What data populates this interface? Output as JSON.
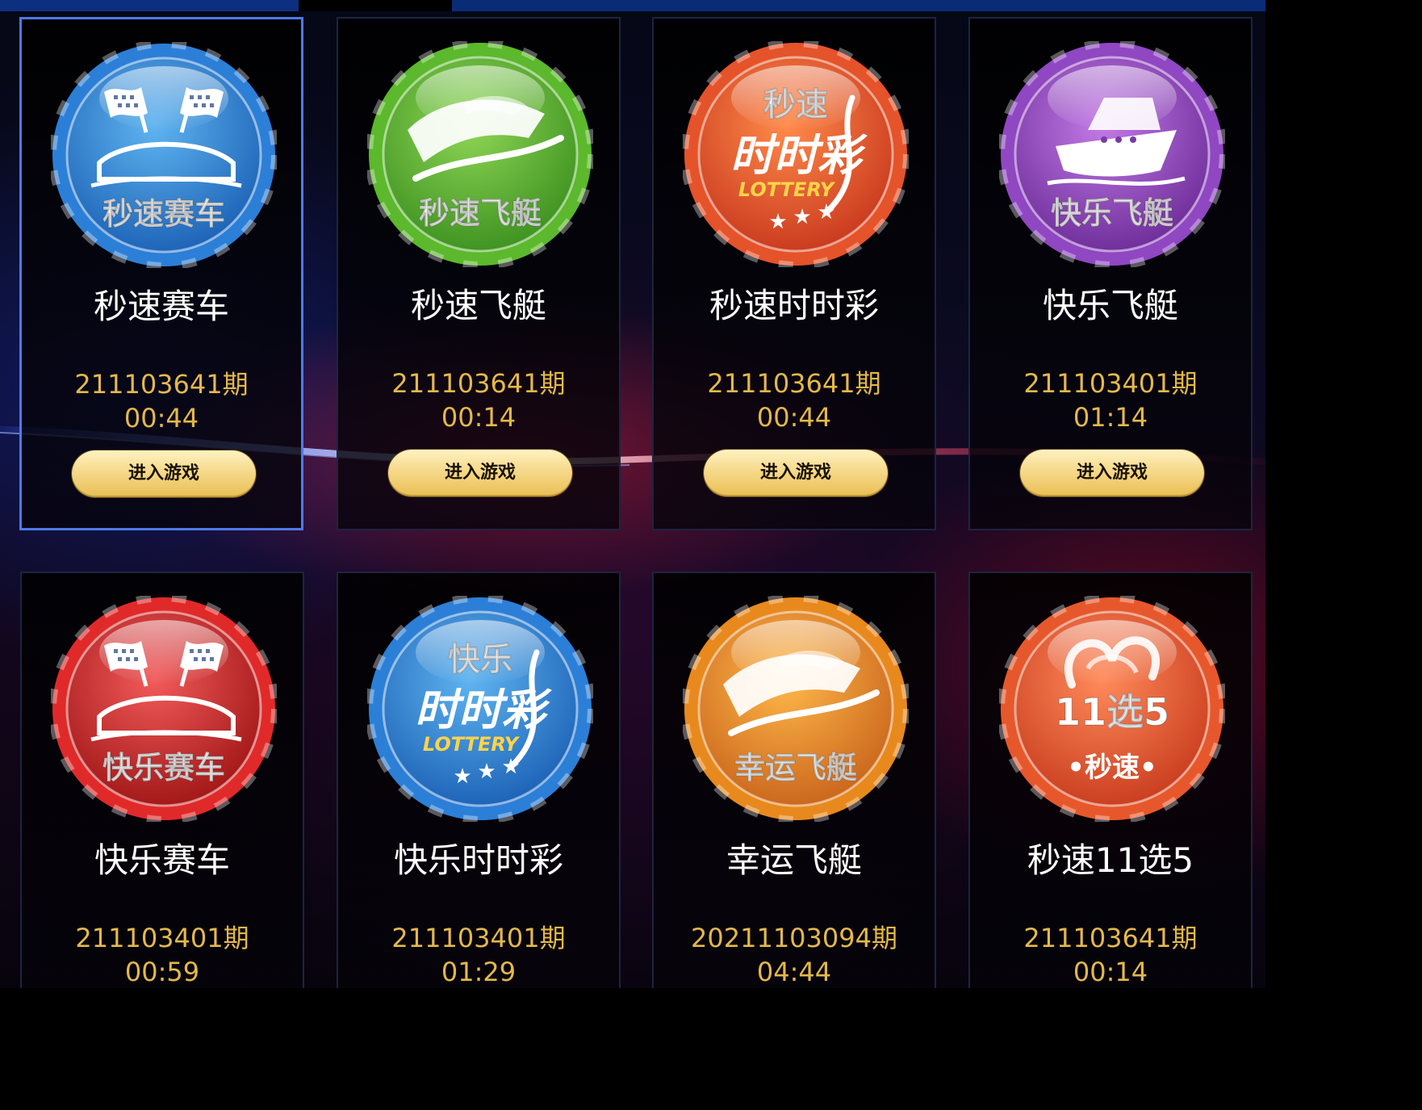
{
  "enter_label": "进入游戏",
  "games": [
    {
      "name": "秒速赛车",
      "badge_text": "秒速赛车",
      "badge_icon": "racing-flags-car-icon",
      "issue": "211103641期",
      "timer": "00:44",
      "color_light": "#5fb4f0",
      "color_dark": "#1a5fb4",
      "rim": "#2c7fd6",
      "selected": true
    },
    {
      "name": "秒速飞艇",
      "badge_text": "秒速飞艇",
      "badge_icon": "speedboat-icon",
      "issue": "211103641期",
      "timer": "00:14",
      "color_light": "#8fd656",
      "color_dark": "#3a8f1e",
      "rim": "#5cb82c",
      "selected": false
    },
    {
      "name": "秒速时时彩",
      "badge_text": "秒速",
      "badge_sub": "LOTTERY",
      "badge_icon": "lottery-stars-icon",
      "issue": "211103641期",
      "timer": "00:44",
      "color_light": "#ff8a4a",
      "color_dark": "#c7361c",
      "rim": "#e5532a",
      "selected": false
    },
    {
      "name": "快乐飞艇",
      "badge_text": "快乐飞艇",
      "badge_icon": "cruise-ship-icon",
      "issue": "211103401期",
      "timer": "01:14",
      "color_light": "#c27ae6",
      "color_dark": "#6a2a96",
      "rim": "#9047c2",
      "selected": false
    },
    {
      "name": "快乐赛车",
      "badge_text": "快乐赛车",
      "badge_icon": "racing-flags-car-icon",
      "issue": "211103401期",
      "timer": "00:59",
      "color_light": "#f25a5a",
      "color_dark": "#9e1414",
      "rim": "#e02a2a",
      "selected": false
    },
    {
      "name": "快乐时时彩",
      "badge_text": "快乐",
      "badge_sub": "LOTTERY",
      "badge_icon": "lottery-stars-icon",
      "issue": "211103401期",
      "timer": "01:29",
      "color_light": "#5fb4f0",
      "color_dark": "#1a5fb4",
      "rim": "#2c7fd6",
      "selected": false
    },
    {
      "name": "幸运飞艇",
      "badge_text": "幸运飞艇",
      "badge_icon": "speedboat-icon",
      "issue": "20211103094期",
      "timer": "04:44",
      "color_light": "#ffb84a",
      "color_dark": "#c8621a",
      "rim": "#e8891e",
      "selected": false
    },
    {
      "name": "秒速11选5",
      "badge_text": "11选5",
      "badge_sub": "•秒速•",
      "badge_icon": "eleven-pick-five-icon",
      "issue": "211103641期",
      "timer": "00:14",
      "color_light": "#ff8a5a",
      "color_dark": "#c73a1c",
      "rim": "#e6582c",
      "selected": false
    }
  ]
}
